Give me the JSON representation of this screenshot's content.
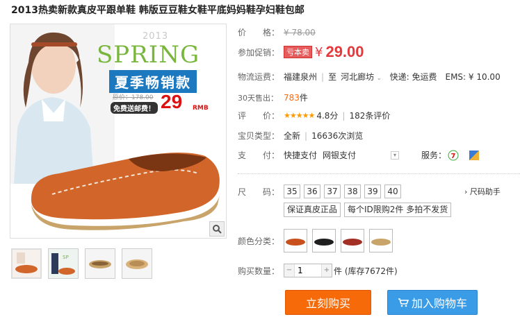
{
  "title": "2013热卖新款真皮平跟单鞋 韩版豆豆鞋女鞋平底妈妈鞋孕妇鞋包邮",
  "banner": {
    "year": "2013",
    "spring": "SPRING",
    "summer": "夏季畅销款",
    "old_price": "原价：178.00",
    "shipping": "免费送邮费！",
    "price": "29",
    "unit": "RMB"
  },
  "price": {
    "label": "价　　格：",
    "old": "¥ 78.00"
  },
  "promo": {
    "label": "参加促销：",
    "tag": "亏本卖",
    "symbol": "¥",
    "value": "29.00"
  },
  "shipping": {
    "label": "物流运费：",
    "from": "福建泉州",
    "to_prefix": "至",
    "to": "河北廊坊",
    "express": "快递: 免运费",
    "ems": "EMS: ¥ 10.00"
  },
  "sold": {
    "label": "30天售出：",
    "count": "783",
    "unit": "件"
  },
  "rating": {
    "label": "评　　价：",
    "stars": "★★★★★",
    "score": "4.8分",
    "reviews": "182条评价"
  },
  "type": {
    "label": "宝贝类型：",
    "value": "全新",
    "views": "16636次浏览"
  },
  "payment": {
    "label": "支　　付：",
    "method1": "快捷支付",
    "method2": "网银支付",
    "service_label": "服务："
  },
  "size": {
    "label": "尺　　码：",
    "options": [
      "35",
      "36",
      "37",
      "38",
      "39",
      "40"
    ],
    "helper": "尺码助手"
  },
  "tags": [
    "保证真皮正品",
    "每个ID限购2件 多拍不发货"
  ],
  "colors": {
    "label": "颜色分类：",
    "swatches": [
      "#c7501c",
      "#1e1e1e",
      "#a33024",
      "#c9a468"
    ]
  },
  "quantity": {
    "label": "购买数量：",
    "value": "1",
    "stock": "件 (库存7672件)"
  },
  "buttons": {
    "buy": "立刻购买",
    "cart": "加入购物车"
  }
}
